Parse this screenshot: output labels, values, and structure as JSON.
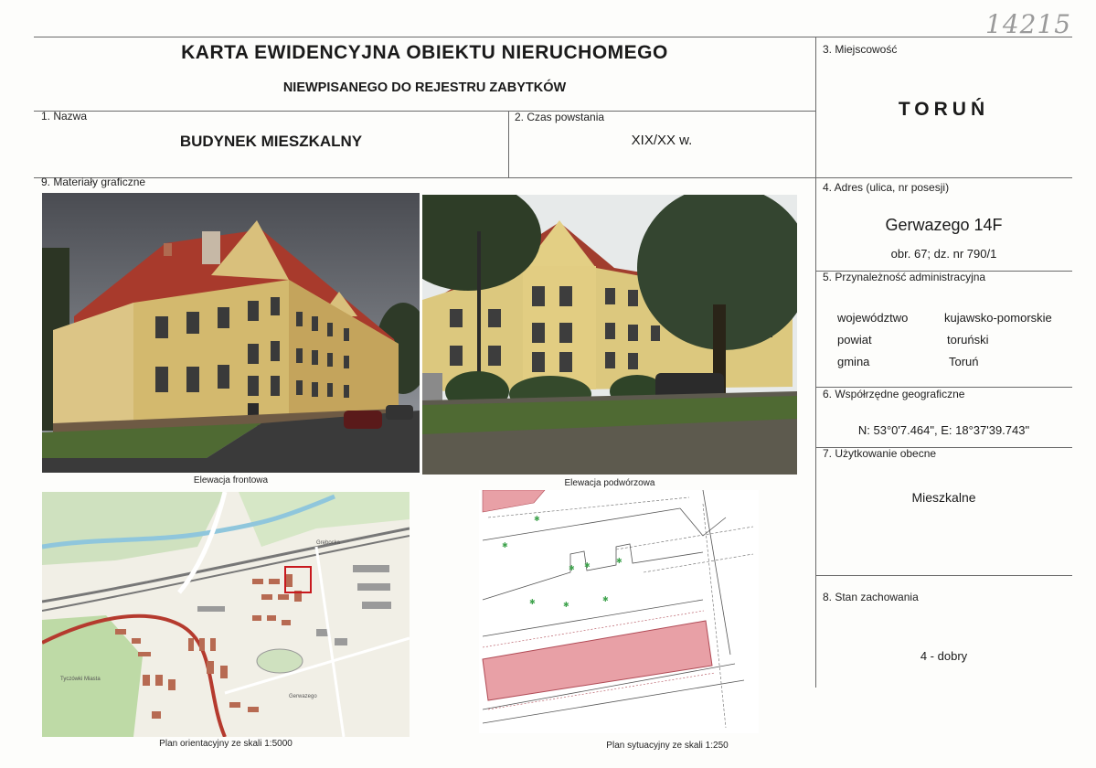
{
  "handwritten_number": "14215",
  "header": {
    "title": "KARTA EWIDENCYJNA OBIEKTU NIERUCHOMEGO",
    "subtitle": "NIEWPISANEGO DO REJESTRU ZABYTKÓW"
  },
  "fields": {
    "name_label": "1. Nazwa",
    "name_value": "BUDYNEK MIESZKALNY",
    "date_label": "2. Czas powstania",
    "date_value": "XIX/XX w.",
    "place_label": "3. Miejscowość",
    "place_value": "TORUŃ",
    "address_label": "4. Adres (ulica, nr posesji)",
    "address_value": "Gerwazego 14F",
    "address_detail": "obr. 67; dz. nr 790/1",
    "admin_label": "5. Przynależność administracyjna",
    "admin_rows": [
      {
        "key": "województwo",
        "value": "kujawsko-pomorskie"
      },
      {
        "key": "powiat",
        "value": "toruński"
      },
      {
        "key": "gmina",
        "value": "Toruń"
      }
    ],
    "coords_label": "6. Współrzędne geograficzne",
    "coords_value": "N: 53°0'7.464\", E: 18°37'39.743\"",
    "usage_label": "7. Użytkowanie obecne",
    "usage_value": "Mieszkalne",
    "condition_label": "8. Stan zachowania",
    "condition_value": "4 - dobry",
    "graphics_label": "9. Materiały graficzne"
  },
  "captions": {
    "front": "Elewacja frontowa",
    "courtyard": "Elewacja podwórzowa",
    "orientation_plan": "Plan orientacyjny ze skali 1:5000",
    "site_plan": "Plan sytuacyjny ze skali 1:250"
  },
  "map_labels": {
    "street_top": "Grębocka",
    "river_label": "Tyczówki Miasta",
    "street_mid": "Gerwazego"
  },
  "colors": {
    "building_highlight": "#e8a0a6",
    "map_marker": "#c8191e"
  }
}
